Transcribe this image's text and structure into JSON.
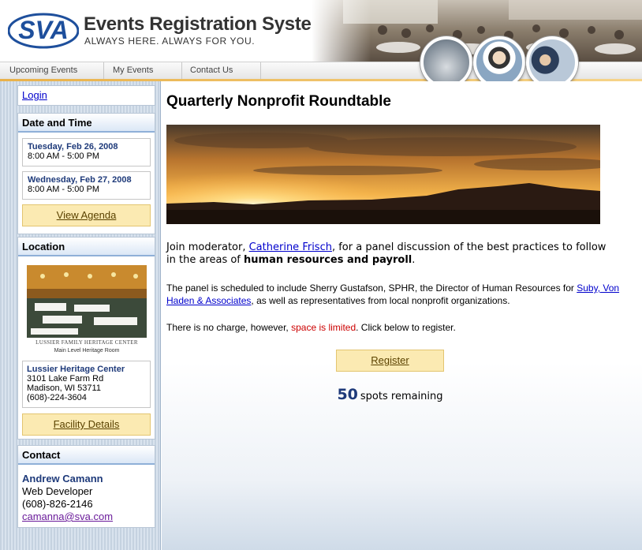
{
  "header": {
    "logo_text": "SVA",
    "title": "Events Registration System",
    "tagline": "ALWAYS HERE. ALWAYS FOR YOU."
  },
  "nav": {
    "tabs": [
      {
        "label": "Upcoming Events"
      },
      {
        "label": "My Events"
      },
      {
        "label": "Contact Us"
      }
    ]
  },
  "sidebar": {
    "login_label": "Login",
    "date_time": {
      "heading": "Date and Time",
      "dates": [
        {
          "day": "Tuesday, Feb 26, 2008",
          "time": "8:00 AM - 5:00 PM"
        },
        {
          "day": "Wednesday, Feb 27, 2008",
          "time": "8:00 AM - 5:00 PM"
        }
      ],
      "agenda_button": "View Agenda"
    },
    "location": {
      "heading": "Location",
      "photo_caption_1": "LUSSIER FAMILY HERITAGE CENTER",
      "photo_caption_2": "Main Level Heritage Room",
      "venue_name": "Lussier Heritage Center",
      "address_1": "3101 Lake Farm Rd",
      "address_2": "Madison, WI 53711",
      "phone": "(608)-224-3604",
      "details_button": "Facility Details"
    },
    "contact": {
      "heading": "Contact",
      "name": "Andrew Camann",
      "title": "Web Developer",
      "phone": "(608)-826-2146",
      "email": "camanna@sva.com"
    }
  },
  "main": {
    "title": "Quarterly Nonprofit Roundtable",
    "intro": {
      "text_1": "Join moderator, ",
      "moderator": "Catherine Frisch",
      "text_2": ", for a panel discussion of the best practices to follow in the areas of ",
      "emphasis": "human resources and payroll",
      "text_3": "."
    },
    "panel": {
      "text_1": "The panel is scheduled to include Sherry Gustafson, SPHR, the Director of Human Resources for ",
      "firm": "Suby, Von Haden & Associates",
      "text_2": ", as well as representatives from local nonprofit organizations."
    },
    "charge": {
      "text_1": "There is no charge, however, ",
      "limited": "space is limited",
      "text_2": ". Click below to register."
    },
    "register_button": "Register",
    "spots_count": "50",
    "spots_label": "spots remaining"
  },
  "colors": {
    "brand_blue": "#1e4f9c",
    "heading_blue": "#1e3a7a",
    "button_yellow": "#fbeab2",
    "warning_red": "#cc0000",
    "link_blue": "#0000cc"
  }
}
